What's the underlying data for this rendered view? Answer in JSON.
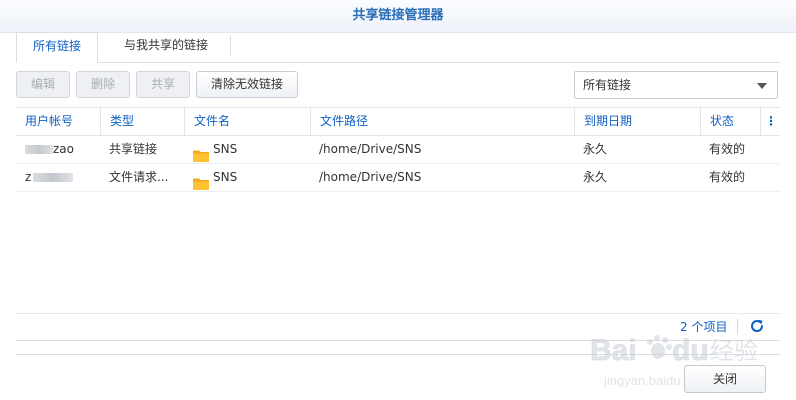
{
  "window": {
    "title": "共享链接管理器"
  },
  "tabs": [
    {
      "label": "所有链接",
      "active": true
    },
    {
      "label": "与我共享的链接",
      "active": false
    }
  ],
  "toolbar": {
    "edit_label": "编辑",
    "delete_label": "删除",
    "share_label": "共享",
    "clear_invalid_label": "清除无效链接"
  },
  "filter": {
    "selected": "所有链接"
  },
  "table": {
    "columns": [
      "用户帐号",
      "类型",
      "文件名",
      "文件路径",
      "到期日期",
      "状态"
    ],
    "rows": [
      {
        "account": "zao",
        "type": "共享链接",
        "filename": "SNS",
        "path": "/home/Drive/SNS",
        "expiry": "永久",
        "status": "有效的"
      },
      {
        "account": "z",
        "type": "文件请求...",
        "filename": "SNS",
        "path": "/home/Drive/SNS",
        "expiry": "永久",
        "status": "有效的"
      }
    ]
  },
  "footer": {
    "item_count": "2 个项目"
  },
  "close_label": "关闭",
  "watermark": {
    "brand": "Baidu经验",
    "url": "jingyan.baidu.com"
  },
  "colors": {
    "accent": "#0f60c5",
    "folder": "#f5a623"
  }
}
